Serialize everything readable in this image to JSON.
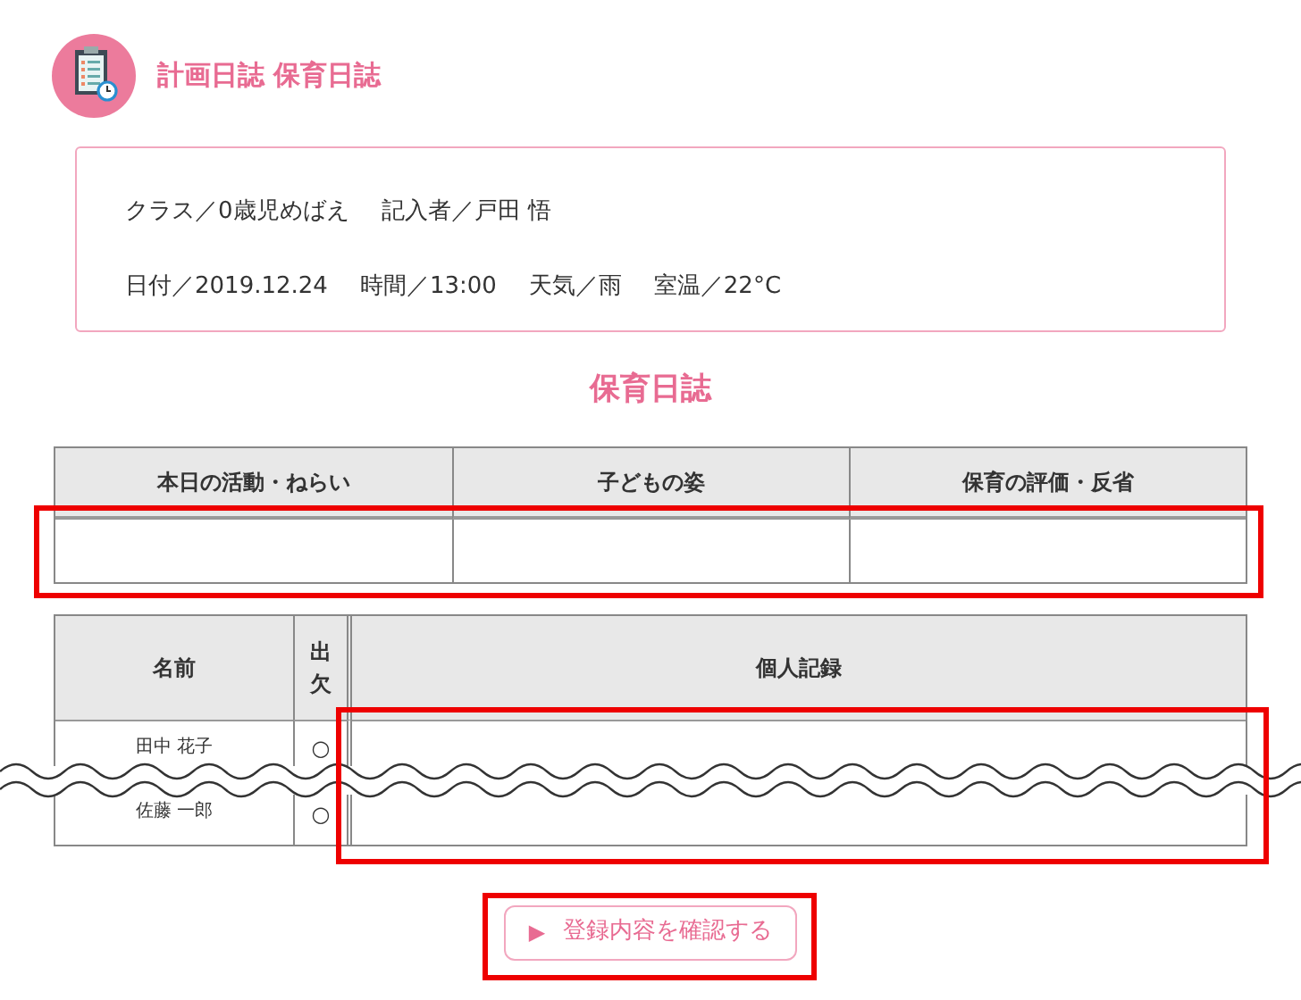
{
  "header": {
    "title": "計画日誌 保育日誌"
  },
  "info": {
    "lines": [
      [
        "クラス／0歳児めばえ",
        "記入者／戸田 悟"
      ],
      [
        "日付／2019.12.24",
        "時間／13:00",
        "天気／雨",
        "室温／22°C"
      ]
    ]
  },
  "section_title": "保育日誌",
  "plan_table": {
    "columns": [
      "本日の活動・ねらい",
      "子どもの姿",
      "保育の評価・反省"
    ]
  },
  "record_table": {
    "columns": [
      "名前",
      "出欠",
      "個人記録"
    ],
    "rows": [
      {
        "name": "田中 花子",
        "attendance": "○"
      },
      {
        "name": "佐藤 一郎",
        "attendance": "○"
      }
    ]
  },
  "confirm_button": {
    "icon": "▶",
    "label": "登録内容を確認する"
  }
}
